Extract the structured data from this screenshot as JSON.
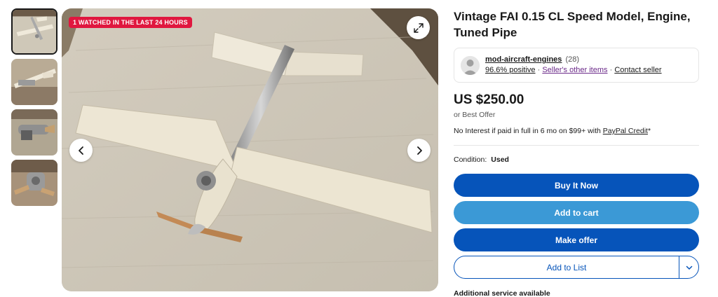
{
  "gallery": {
    "watch_badge": "1 WATCHED IN THE LAST 24 HOURS",
    "thumbnails": [
      {
        "icon": "airplane-photo"
      },
      {
        "icon": "airplane-photo"
      },
      {
        "icon": "engine-photo"
      },
      {
        "icon": "engine-photo"
      }
    ]
  },
  "listing": {
    "title": "Vintage FAI 0.15 CL Speed Model, Engine, Tuned Pipe",
    "price": "US $250.00",
    "best_offer": "or Best Offer",
    "financing_text": "No Interest if paid in full in 6 mo on $99+ with ",
    "financing_link": "PayPal Credit",
    "financing_suffix": "*",
    "condition_label": "Condition:",
    "condition_value": "Used",
    "additional_service": "Additional service available"
  },
  "seller": {
    "name": "mod-aircraft-engines",
    "count": "(28)",
    "positive": "96.6% positive",
    "sep1": " · ",
    "other_items": "Seller's other items",
    "sep2": " · ",
    "contact": "Contact seller"
  },
  "actions": {
    "buy_now": "Buy It Now",
    "add_to_cart": "Add to cart",
    "make_offer": "Make offer",
    "add_to_list": "Add to List"
  },
  "colors": {
    "primary": "#0654ba",
    "secondary": "#3b99d6",
    "badge": "#e0173f"
  }
}
